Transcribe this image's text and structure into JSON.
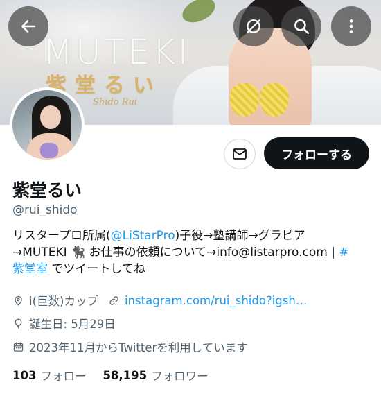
{
  "banner": {
    "brand": "MUTEKI",
    "name": "紫堂るい",
    "signature": "Shido Rui"
  },
  "icons": [
    "back-arrow-icon",
    "not-following-icon",
    "search-icon",
    "more-vertical-icon",
    "mail-icon",
    "location-icon",
    "link-icon",
    "birthday-icon",
    "calendar-icon"
  ],
  "profile": {
    "display_name": "紫堂るい",
    "handle": "@rui_shido",
    "follow_label": "フォローする",
    "bio": {
      "line1_prefix": "リスタープロ所属(",
      "line1_mention": "@LiStarPro",
      "line1_suffix": ")子役→塾講師→グラビア",
      "line2_text": "→MUTEKI 🐈‍⬛ お仕事の依頼について→info@listarpro.com | ",
      "line2_hashtag": "#",
      "line3_hashtag": "紫堂室",
      "line3_suffix": " でツイートしてね"
    },
    "location": "i(巨数)カップ",
    "website": "instagram.com/rui_shido?igsh…",
    "birthday": "誕生日: 5月29日",
    "joined": "2023年11月からTwitterを利用しています",
    "following_count": "103",
    "following_label": "フォロー",
    "followers_count": "58,195",
    "followers_label": "フォロワー"
  },
  "colors": {
    "accent": "#1d9bf0",
    "text": "#0f1419",
    "secondary": "#536471",
    "button_dark": "#0f1419"
  }
}
